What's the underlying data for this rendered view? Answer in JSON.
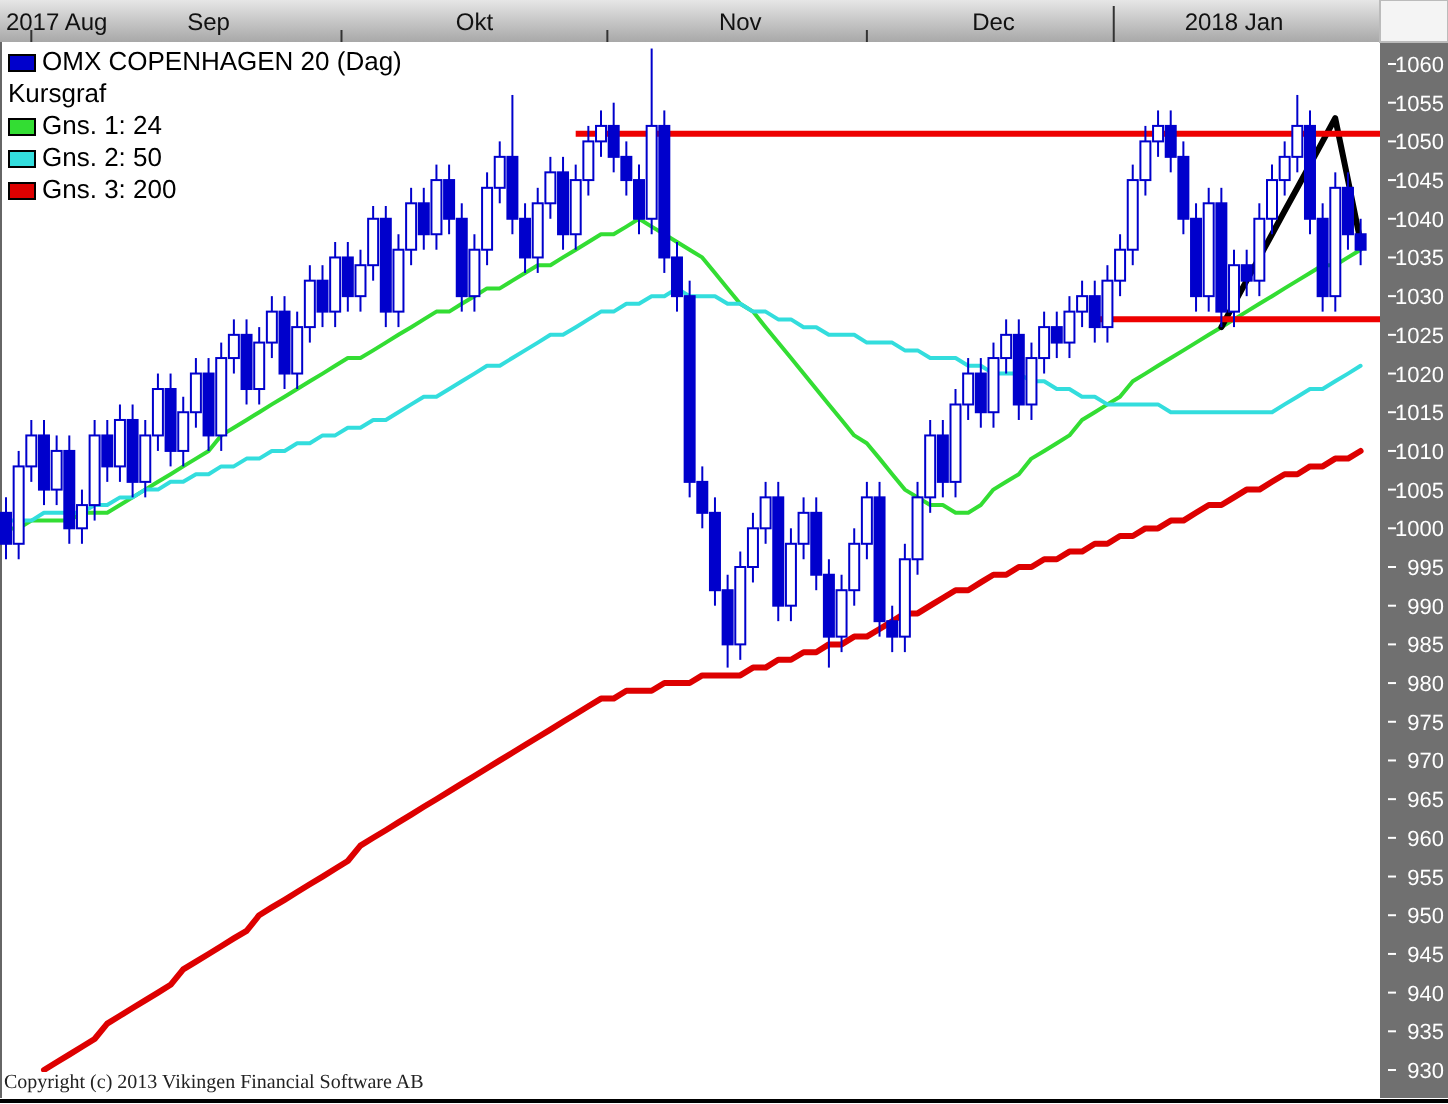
{
  "legend": [
    {
      "label": "OMX COPENHAGEN 20 (Dag)",
      "color": "#0000cc"
    },
    {
      "label": "Kursgraf"
    }
  ],
  "chart_data": {
    "type": "candlestick",
    "categories": [
      null,
      null,
      null,
      null,
      "2017 Aug",
      null,
      null,
      null,
      null,
      null,
      null,
      null,
      null,
      null,
      null,
      null,
      "Sep",
      null,
      null,
      null,
      null,
      null,
      null,
      null,
      null,
      null,
      null,
      null,
      null,
      null,
      null,
      null,
      null,
      null,
      null,
      null,
      null,
      "Okt",
      null,
      null,
      null,
      null,
      null,
      null,
      null,
      null,
      null,
      null,
      null,
      null,
      null,
      null,
      null,
      null,
      null,
      null,
      null,
      null,
      "Nov",
      null,
      null,
      null,
      null,
      null,
      null,
      null,
      null,
      null,
      null,
      null,
      null,
      null,
      null,
      null,
      null,
      null,
      null,
      null,
      "Dec",
      null,
      null,
      null,
      null,
      null,
      null,
      null,
      null,
      null,
      null,
      null,
      null,
      null,
      null,
      null,
      null,
      null,
      null,
      "2018 Jan",
      null,
      null,
      null,
      null,
      null,
      null,
      null,
      null,
      null,
      null
    ],
    "ylim": [
      930,
      1060
    ],
    "yticks": [
      930,
      935,
      940,
      945,
      950,
      955,
      960,
      965,
      970,
      975,
      980,
      985,
      990,
      995,
      1000,
      1005,
      1010,
      1015,
      1020,
      1025,
      1030,
      1035,
      1040,
      1045,
      1050,
      1055,
      1060
    ],
    "ohlc": [
      [
        1002,
        1004,
        996,
        998
      ],
      [
        998,
        1010,
        996,
        1008
      ],
      [
        1008,
        1014,
        1006,
        1012
      ],
      [
        1012,
        1014,
        1003,
        1005
      ],
      [
        1005,
        1012,
        1003,
        1010
      ],
      [
        1010,
        1012,
        998,
        1000
      ],
      [
        1000,
        1005,
        998,
        1003
      ],
      [
        1003,
        1014,
        1001,
        1012
      ],
      [
        1012,
        1014,
        1006,
        1008
      ],
      [
        1008,
        1016,
        1006,
        1014
      ],
      [
        1014,
        1016,
        1004,
        1006
      ],
      [
        1006,
        1014,
        1004,
        1012
      ],
      [
        1012,
        1020,
        1010,
        1018
      ],
      [
        1018,
        1020,
        1008,
        1010
      ],
      [
        1010,
        1017,
        1008,
        1015
      ],
      [
        1015,
        1022,
        1013,
        1020
      ],
      [
        1020,
        1022,
        1010,
        1012
      ],
      [
        1012,
        1024,
        1010,
        1022
      ],
      [
        1022,
        1027,
        1020,
        1025
      ],
      [
        1025,
        1027,
        1016,
        1018
      ],
      [
        1018,
        1026,
        1016,
        1024
      ],
      [
        1024,
        1030,
        1022,
        1028
      ],
      [
        1028,
        1030,
        1018,
        1020
      ],
      [
        1020,
        1028,
        1018,
        1026
      ],
      [
        1026,
        1034,
        1024,
        1032
      ],
      [
        1032,
        1034,
        1026,
        1028
      ],
      [
        1028,
        1037,
        1026,
        1035
      ],
      [
        1035,
        1037,
        1028,
        1030
      ],
      [
        1030,
        1036,
        1028,
        1034
      ],
      [
        1034,
        1042,
        1032,
        1040
      ],
      [
        1040,
        1042,
        1026,
        1028
      ],
      [
        1028,
        1038,
        1026,
        1036
      ],
      [
        1036,
        1044,
        1034,
        1042
      ],
      [
        1042,
        1044,
        1036,
        1038
      ],
      [
        1038,
        1047,
        1036,
        1045
      ],
      [
        1045,
        1047,
        1038,
        1040
      ],
      [
        1040,
        1042,
        1028,
        1030
      ],
      [
        1030,
        1038,
        1028,
        1036
      ],
      [
        1036,
        1046,
        1034,
        1044
      ],
      [
        1044,
        1050,
        1042,
        1048
      ],
      [
        1048,
        1056,
        1038,
        1040
      ],
      [
        1040,
        1042,
        1033,
        1035
      ],
      [
        1035,
        1044,
        1033,
        1042
      ],
      [
        1042,
        1048,
        1040,
        1046
      ],
      [
        1046,
        1048,
        1036,
        1038
      ],
      [
        1038,
        1047,
        1036,
        1045
      ],
      [
        1045,
        1052,
        1043,
        1050
      ],
      [
        1050,
        1054,
        1048,
        1052
      ],
      [
        1052,
        1055,
        1046,
        1048
      ],
      [
        1048,
        1050,
        1043,
        1045
      ],
      [
        1045,
        1047,
        1038,
        1040
      ],
      [
        1040,
        1062,
        1038,
        1052
      ],
      [
        1052,
        1054,
        1033,
        1035
      ],
      [
        1035,
        1037,
        1028,
        1030
      ],
      [
        1030,
        1032,
        1004,
        1006
      ],
      [
        1006,
        1008,
        1000,
        1002
      ],
      [
        1002,
        1004,
        990,
        992
      ],
      [
        992,
        994,
        982,
        985
      ],
      [
        985,
        997,
        983,
        995
      ],
      [
        995,
        1002,
        993,
        1000
      ],
      [
        1000,
        1006,
        998,
        1004
      ],
      [
        1004,
        1006,
        988,
        990
      ],
      [
        990,
        1000,
        988,
        998
      ],
      [
        998,
        1004,
        996,
        1002
      ],
      [
        1002,
        1004,
        992,
        994
      ],
      [
        994,
        996,
        982,
        986
      ],
      [
        986,
        994,
        984,
        992
      ],
      [
        992,
        1000,
        990,
        998
      ],
      [
        998,
        1006,
        996,
        1004
      ],
      [
        1004,
        1006,
        986,
        988
      ],
      [
        988,
        990,
        984,
        986
      ],
      [
        986,
        998,
        984,
        996
      ],
      [
        996,
        1006,
        994,
        1004
      ],
      [
        1004,
        1014,
        1002,
        1012
      ],
      [
        1012,
        1014,
        1004,
        1006
      ],
      [
        1006,
        1018,
        1004,
        1016
      ],
      [
        1016,
        1022,
        1014,
        1020
      ],
      [
        1020,
        1022,
        1013,
        1015
      ],
      [
        1015,
        1024,
        1013,
        1022
      ],
      [
        1022,
        1027,
        1020,
        1025
      ],
      [
        1025,
        1027,
        1014,
        1016
      ],
      [
        1016,
        1024,
        1014,
        1022
      ],
      [
        1022,
        1028,
        1020,
        1026
      ],
      [
        1026,
        1028,
        1022,
        1024
      ],
      [
        1024,
        1030,
        1022,
        1028
      ],
      [
        1028,
        1032,
        1026,
        1030
      ],
      [
        1030,
        1032,
        1024,
        1026
      ],
      [
        1026,
        1034,
        1024,
        1032
      ],
      [
        1032,
        1038,
        1030,
        1036
      ],
      [
        1036,
        1047,
        1034,
        1045
      ],
      [
        1045,
        1052,
        1043,
        1050
      ],
      [
        1050,
        1054,
        1048,
        1052
      ],
      [
        1052,
        1054,
        1046,
        1048
      ],
      [
        1048,
        1050,
        1038,
        1040
      ],
      [
        1040,
        1042,
        1028,
        1030
      ],
      [
        1030,
        1044,
        1028,
        1042
      ],
      [
        1042,
        1044,
        1026,
        1028
      ],
      [
        1028,
        1036,
        1026,
        1034
      ],
      [
        1034,
        1036,
        1030,
        1032
      ],
      [
        1032,
        1042,
        1030,
        1040
      ],
      [
        1040,
        1047,
        1038,
        1045
      ],
      [
        1045,
        1050,
        1043,
        1048
      ],
      [
        1048,
        1056,
        1046,
        1052
      ],
      [
        1052,
        1054,
        1038,
        1040
      ],
      [
        1040,
        1042,
        1028,
        1030
      ],
      [
        1030,
        1046,
        1028,
        1044
      ],
      [
        1044,
        1046,
        1036,
        1038
      ],
      [
        1038,
        1040,
        1034,
        1036
      ]
    ],
    "series": [
      {
        "name": "Gns. 1: 24",
        "type": "line",
        "color": "#33dd33",
        "values": [
          1000,
          1000,
          1001,
          1001,
          1001,
          1001,
          1002,
          1002,
          1002,
          1003,
          1004,
          1005,
          1006,
          1007,
          1008,
          1009,
          1010,
          1012,
          1013,
          1014,
          1015,
          1016,
          1017,
          1018,
          1019,
          1020,
          1021,
          1022,
          1022,
          1023,
          1024,
          1025,
          1026,
          1027,
          1028,
          1028,
          1029,
          1030,
          1031,
          1031,
          1032,
          1033,
          1034,
          1034,
          1035,
          1036,
          1037,
          1038,
          1038,
          1039,
          1040,
          1039,
          1038,
          1037,
          1036,
          1035,
          1033,
          1031,
          1029,
          1028,
          1026,
          1024,
          1022,
          1020,
          1018,
          1016,
          1014,
          1012,
          1011,
          1009,
          1007,
          1005,
          1004,
          1003,
          1003,
          1002,
          1002,
          1003,
          1005,
          1006,
          1007,
          1009,
          1010,
          1011,
          1012,
          1014,
          1015,
          1016,
          1017,
          1019,
          1020,
          1021,
          1022,
          1023,
          1024,
          1025,
          1026,
          1027,
          1028,
          1029,
          1030,
          1031,
          1032,
          1033,
          1034,
          1034,
          1035,
          1036
        ]
      },
      {
        "name": "Gns. 2: 50",
        "type": "line",
        "color": "#33dddd",
        "values": [
          1001,
          1001,
          1001,
          1002,
          1002,
          1002,
          1002,
          1003,
          1003,
          1004,
          1004,
          1005,
          1005,
          1006,
          1006,
          1007,
          1007,
          1008,
          1008,
          1009,
          1009,
          1010,
          1010,
          1011,
          1011,
          1012,
          1012,
          1013,
          1013,
          1014,
          1014,
          1015,
          1016,
          1017,
          1017,
          1018,
          1019,
          1020,
          1021,
          1021,
          1022,
          1023,
          1024,
          1025,
          1025,
          1026,
          1027,
          1028,
          1028,
          1029,
          1029,
          1030,
          1030,
          1031,
          1030,
          1030,
          1030,
          1029,
          1029,
          1028,
          1028,
          1027,
          1027,
          1026,
          1026,
          1025,
          1025,
          1025,
          1024,
          1024,
          1024,
          1023,
          1023,
          1022,
          1022,
          1022,
          1021,
          1021,
          1020,
          1020,
          1020,
          1019,
          1019,
          1018,
          1018,
          1017,
          1017,
          1016,
          1016,
          1016,
          1016,
          1016,
          1015,
          1015,
          1015,
          1015,
          1015,
          1015,
          1015,
          1015,
          1015,
          1016,
          1017,
          1018,
          1018,
          1019,
          1020,
          1021
        ]
      },
      {
        "name": "Gns. 3: 200",
        "type": "line",
        "color": "#dd0000",
        "values": [
          null,
          null,
          null,
          930,
          931,
          932,
          933,
          934,
          936,
          937,
          938,
          939,
          940,
          941,
          943,
          944,
          945,
          946,
          947,
          948,
          950,
          951,
          952,
          953,
          954,
          955,
          956,
          957,
          959,
          960,
          961,
          962,
          963,
          964,
          965,
          966,
          967,
          968,
          969,
          970,
          971,
          972,
          973,
          974,
          975,
          976,
          977,
          978,
          978,
          979,
          979,
          979,
          980,
          980,
          980,
          981,
          981,
          981,
          981,
          982,
          982,
          983,
          983,
          984,
          984,
          985,
          985,
          986,
          986,
          987,
          988,
          989,
          989,
          990,
          991,
          992,
          992,
          993,
          994,
          994,
          995,
          995,
          996,
          996,
          997,
          997,
          998,
          998,
          999,
          999,
          1000,
          1000,
          1001,
          1001,
          1002,
          1003,
          1003,
          1004,
          1005,
          1005,
          1006,
          1007,
          1007,
          1008,
          1008,
          1009,
          1009,
          1010
        ]
      },
      {
        "type": "line",
        "color": "#000000",
        "values": [
          null,
          null,
          null,
          null,
          null,
          null,
          null,
          null,
          null,
          null,
          null,
          null,
          null,
          null,
          null,
          null,
          null,
          null,
          null,
          null,
          null,
          null,
          null,
          null,
          null,
          null,
          null,
          null,
          null,
          null,
          null,
          null,
          null,
          null,
          null,
          null,
          null,
          null,
          null,
          null,
          null,
          null,
          null,
          null,
          null,
          null,
          null,
          null,
          null,
          null,
          null,
          null,
          null,
          null,
          null,
          null,
          null,
          null,
          null,
          null,
          null,
          null,
          null,
          null,
          null,
          null,
          null,
          null,
          null,
          null,
          null,
          null,
          null,
          null,
          null,
          null,
          null,
          null,
          null,
          null,
          null,
          null,
          null,
          null,
          null,
          null,
          null,
          null,
          null,
          null,
          null,
          null,
          null,
          null,
          null,
          null,
          1026,
          1029,
          1032,
          1035,
          1038,
          1041,
          1044,
          1047,
          1050,
          1053,
          1045,
          1037
        ]
      }
    ],
    "ref_lines": [
      {
        "axis": "y",
        "value": 1051
      },
      {
        "axis": "y",
        "value": 1027
      }
    ]
  },
  "copyright": "Copyright (c) 2013 Vikingen Financial Software AB"
}
